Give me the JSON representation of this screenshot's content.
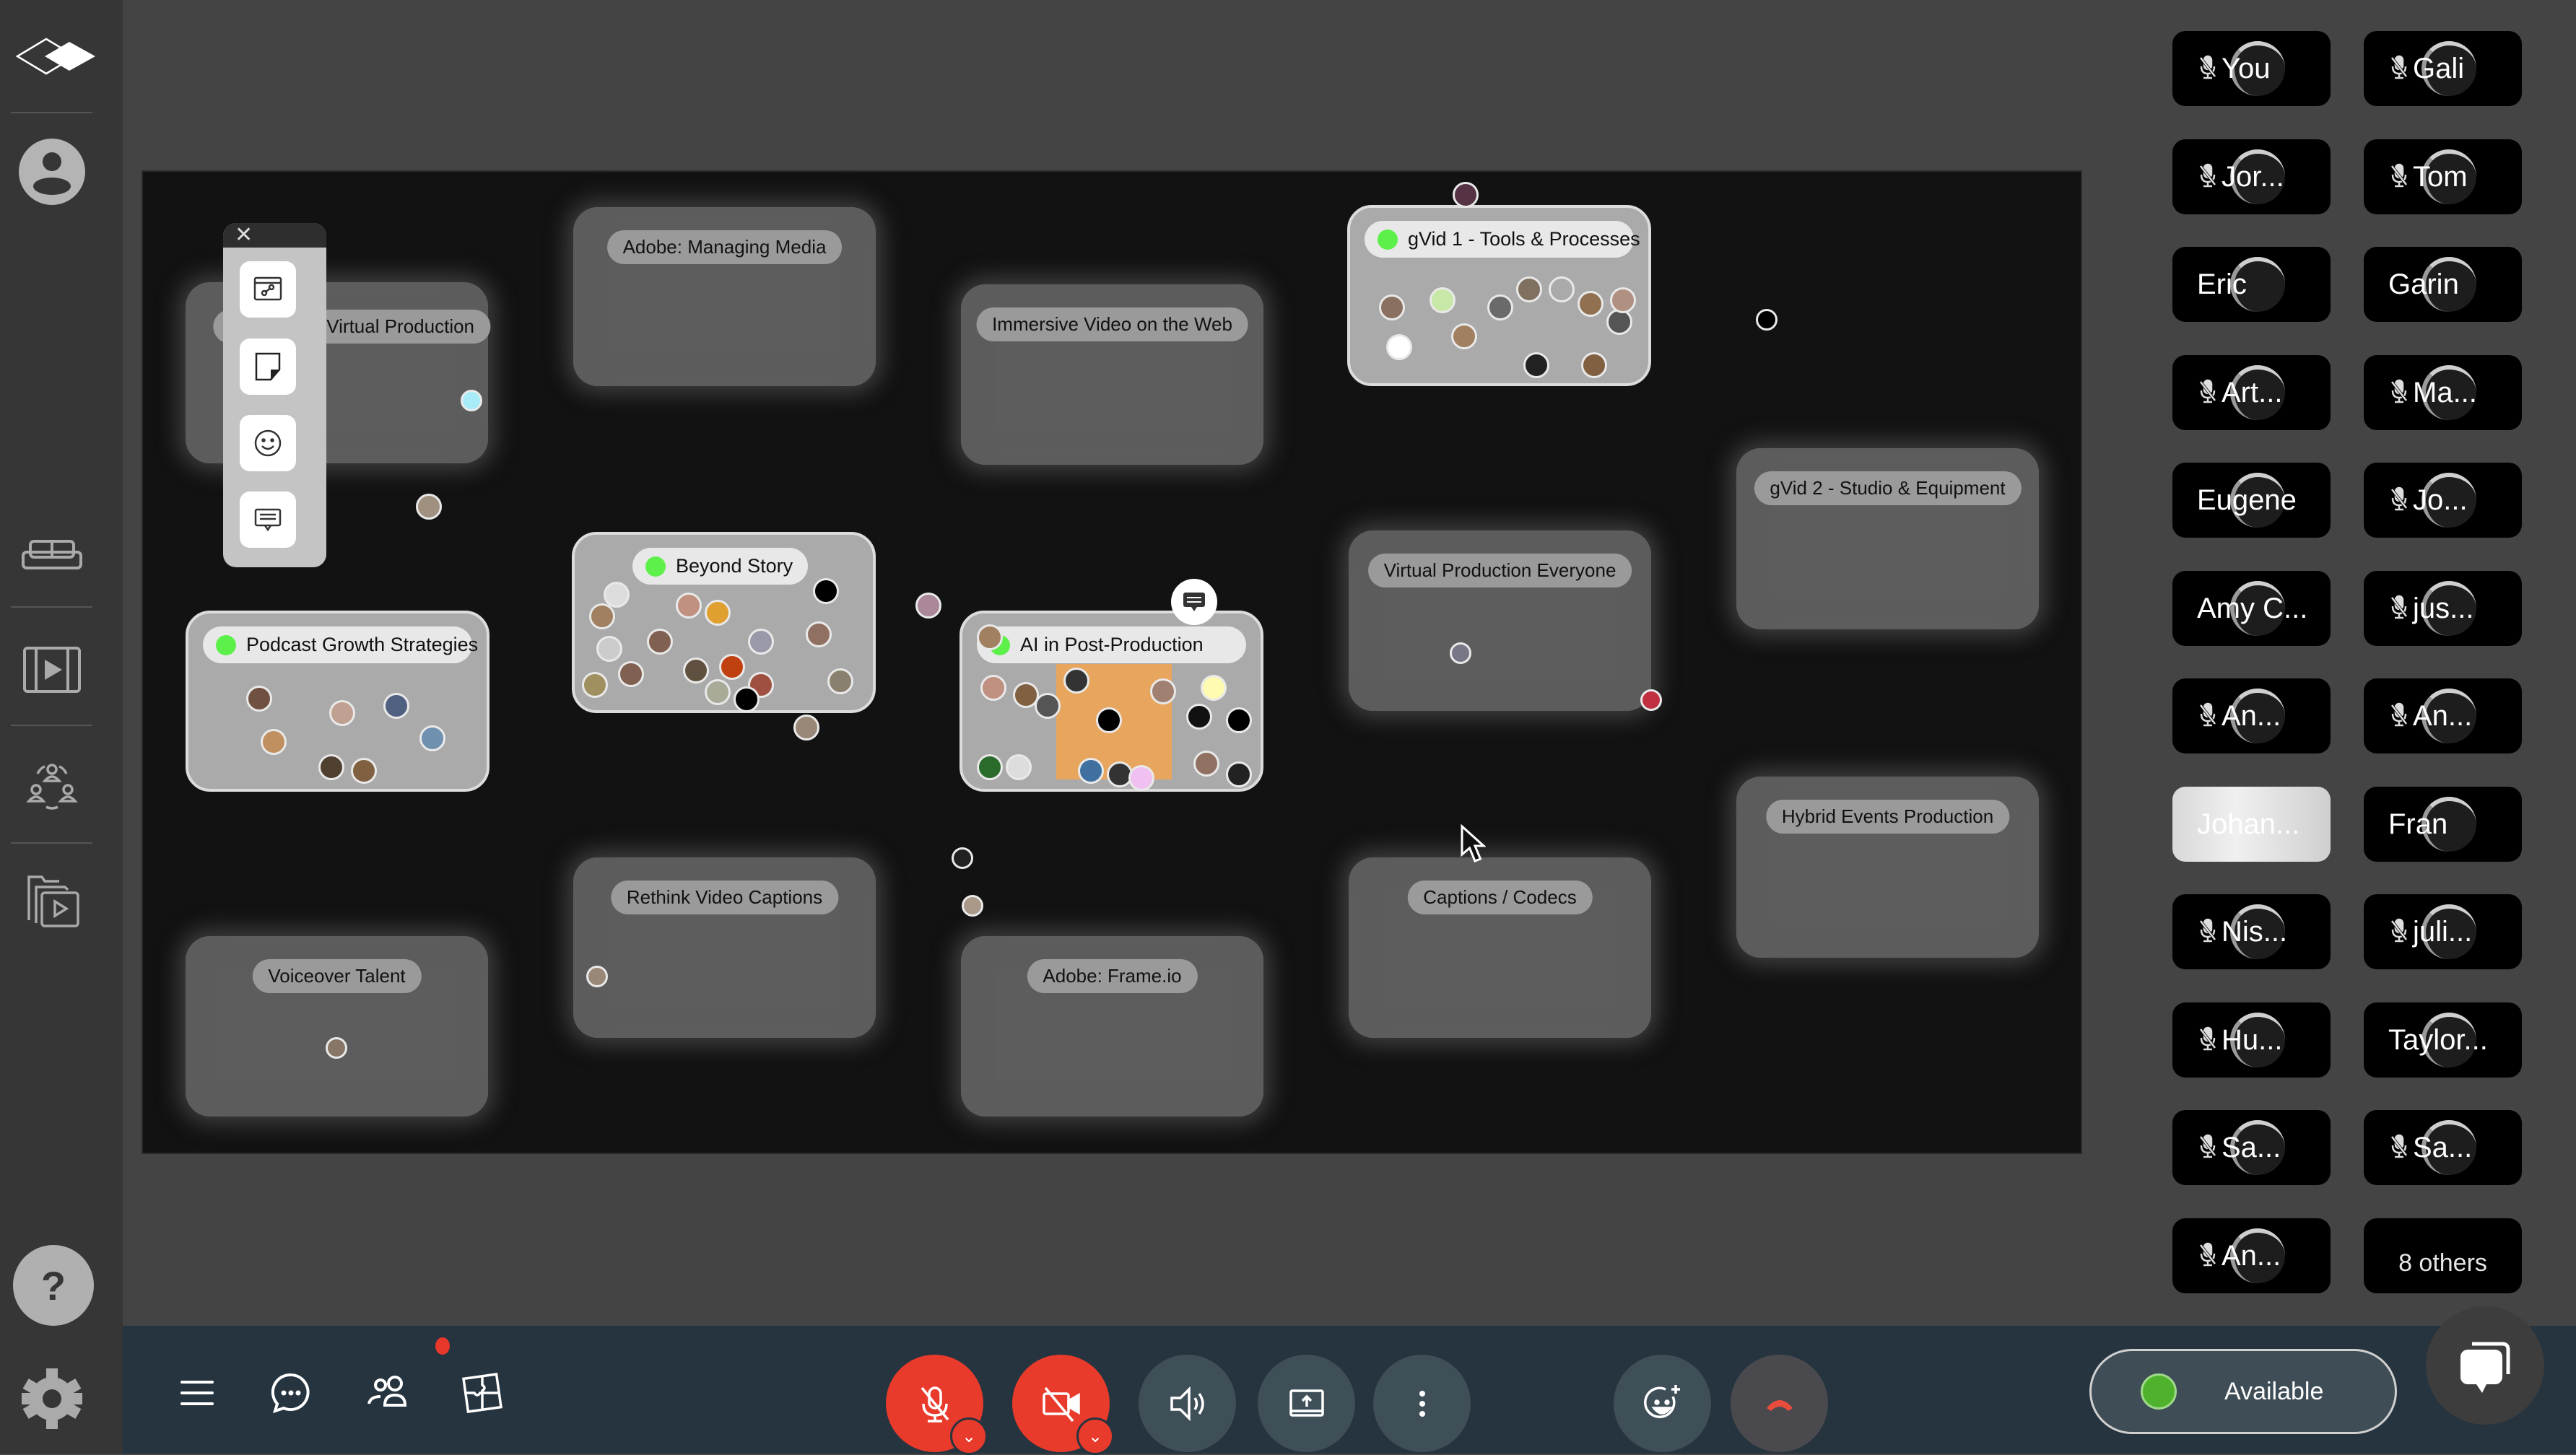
{
  "sidebar": {
    "items": [
      {
        "name": "logo",
        "icon": "diamond-logo-icon"
      },
      {
        "name": "profile",
        "icon": "user-circle-icon"
      },
      {
        "name": "lounge",
        "icon": "sofa-icon"
      },
      {
        "name": "media",
        "icon": "film-play-icon"
      },
      {
        "name": "networking",
        "icon": "people-circle-icon"
      },
      {
        "name": "media-library",
        "icon": "folder-play-icon"
      }
    ],
    "help_label": "?",
    "settings_icon": "gear-icon"
  },
  "toolbox": {
    "close_label": "✕",
    "tools": [
      {
        "name": "embed-link",
        "icon": "browser-link-icon"
      },
      {
        "name": "sticky-note",
        "icon": "sticky-note-icon"
      },
      {
        "name": "emoji",
        "icon": "smiley-icon"
      },
      {
        "name": "message",
        "icon": "message-icon"
      }
    ]
  },
  "rooms": [
    {
      "name": "PeopleDev Virtual Production",
      "active": false
    },
    {
      "name": "Adobe: Managing Media",
      "active": false
    },
    {
      "name": "Immersive Video on the Web",
      "active": false
    },
    {
      "name": "gVid 1 - Tools & Processes",
      "active": true
    },
    {
      "name": "gVid 2 - Studio & Equipment",
      "active": false
    },
    {
      "name": "Beyond Story",
      "active": true
    },
    {
      "name": "Podcast Growth Strategies",
      "active": true
    },
    {
      "name": "AI in Post-Production",
      "active": true
    },
    {
      "name": "Virtual Production Everyone",
      "active": false
    },
    {
      "name": "Hybrid Events Production",
      "active": false
    },
    {
      "name": "Rethink Video Captions",
      "active": false
    },
    {
      "name": "Captions / Codecs",
      "active": false
    },
    {
      "name": "Voiceover Talent",
      "active": false
    },
    {
      "name": "Adobe: Frame.io",
      "active": false
    }
  ],
  "participants": [
    {
      "name": "You",
      "muted": true
    },
    {
      "name": "Gali",
      "muted": true
    },
    {
      "name": "Jor...",
      "muted": true
    },
    {
      "name": "Tom",
      "muted": true
    },
    {
      "name": "Eric",
      "muted": false
    },
    {
      "name": "Garin",
      "muted": false
    },
    {
      "name": "Art...",
      "muted": true
    },
    {
      "name": "Ma...",
      "muted": true
    },
    {
      "name": "Eugene",
      "muted": false
    },
    {
      "name": "Jo...",
      "muted": true
    },
    {
      "name": "Amy C...",
      "muted": false
    },
    {
      "name": "jus...",
      "muted": true
    },
    {
      "name": "An...",
      "muted": true
    },
    {
      "name": "An...",
      "muted": true
    },
    {
      "name": "Johan...",
      "muted": false,
      "video": true
    },
    {
      "name": "Fran",
      "muted": false
    },
    {
      "name": "Nis...",
      "muted": true
    },
    {
      "name": "juli...",
      "muted": true
    },
    {
      "name": "Hu...",
      "muted": true
    },
    {
      "name": "Taylor...",
      "muted": false
    },
    {
      "name": "Sa...",
      "muted": true
    },
    {
      "name": "Sa...",
      "muted": true
    },
    {
      "name": "An...",
      "muted": true
    },
    {
      "name": "8 others",
      "others": true
    }
  ],
  "bottombar": {
    "menu_icon": "hamburger-icon",
    "chat_icon": "chat-bubble-icon",
    "chat_has_notification": true,
    "people_icon": "people-icon",
    "apps_icon": "puzzle-icon",
    "controls": [
      {
        "name": "microphone",
        "state": "muted",
        "icon": "mic-off-icon"
      },
      {
        "name": "camera",
        "state": "off",
        "icon": "camera-off-icon"
      },
      {
        "name": "speaker",
        "icon": "speaker-icon"
      },
      {
        "name": "share-screen",
        "icon": "share-screen-icon"
      },
      {
        "name": "more",
        "icon": "more-vertical-icon"
      },
      {
        "name": "reactions",
        "icon": "emoji-add-icon"
      },
      {
        "name": "leave",
        "icon": "hang-up-icon"
      }
    ],
    "status": {
      "label": "Available",
      "color": "#4fb22c"
    },
    "support_chat_icon": "support-chat-icon"
  },
  "colors": {
    "accent_red": "#e83b2b",
    "live_green": "#5ef04a",
    "available_green": "#4fb22c"
  }
}
